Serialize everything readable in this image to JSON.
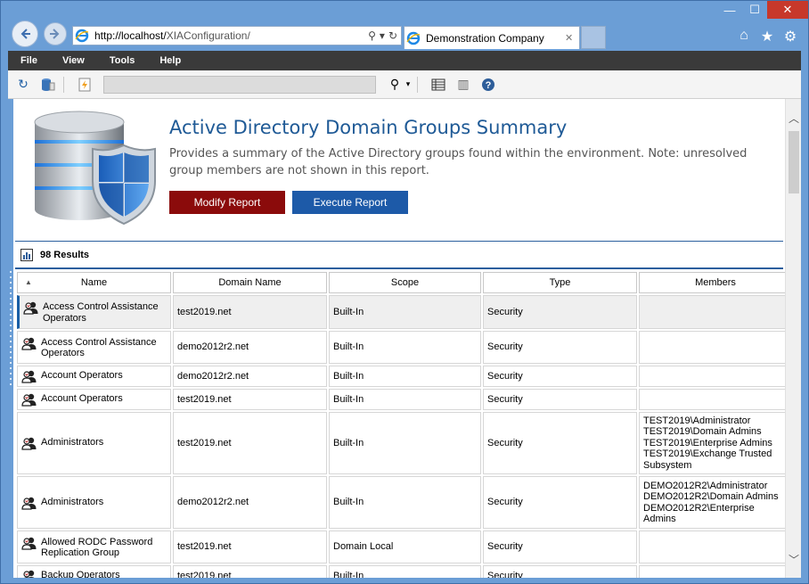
{
  "browser": {
    "url_host": "http://localhost/",
    "url_path": "XIAConfiguration/",
    "tab_title": "Demonstration Company",
    "window_controls": {
      "minimize": "—",
      "maximize": "☐",
      "close": "✕"
    }
  },
  "menu": {
    "items": [
      "File",
      "View",
      "Tools",
      "Help"
    ]
  },
  "report": {
    "title": "Active Directory Domain Groups Summary",
    "description": "Provides a summary of the Active Directory groups found within the environment. Note: unresolved group members are not shown in this report.",
    "modify_label": "Modify Report",
    "execute_label": "Execute Report",
    "results_label": "98 Results"
  },
  "table": {
    "columns": [
      "Name",
      "Domain Name",
      "Scope",
      "Type",
      "Members"
    ],
    "rows": [
      {
        "name": "Access Control Assistance Operators",
        "domain": "test2019.net",
        "scope": "Built-In",
        "type": "Security",
        "members": []
      },
      {
        "name": "Access Control Assistance Operators",
        "domain": "demo2012r2.net",
        "scope": "Built-In",
        "type": "Security",
        "members": []
      },
      {
        "name": "Account Operators",
        "domain": "demo2012r2.net",
        "scope": "Built-In",
        "type": "Security",
        "members": []
      },
      {
        "name": "Account Operators",
        "domain": "test2019.net",
        "scope": "Built-In",
        "type": "Security",
        "members": []
      },
      {
        "name": "Administrators",
        "domain": "test2019.net",
        "scope": "Built-In",
        "type": "Security",
        "members": [
          "TEST2019\\Administrator",
          "TEST2019\\Domain Admins",
          "TEST2019\\Enterprise Admins",
          "TEST2019\\Exchange Trusted Subsystem"
        ]
      },
      {
        "name": "Administrators",
        "domain": "demo2012r2.net",
        "scope": "Built-In",
        "type": "Security",
        "members": [
          "DEMO2012R2\\Administrator",
          "DEMO2012R2\\Domain Admins",
          "DEMO2012R2\\Enterprise Admins"
        ]
      },
      {
        "name": "Allowed RODC Password Replication Group",
        "domain": "test2019.net",
        "scope": "Domain Local",
        "type": "Security",
        "members": []
      },
      {
        "name": "Backup Operators",
        "domain": "test2019.net",
        "scope": "Built-In",
        "type": "Security",
        "members": []
      }
    ]
  },
  "colors": {
    "title": "#1f5a96",
    "modify_button": "#8b0b0b",
    "execute_button": "#1d5aa8",
    "menubar": "#3a3a3a",
    "frame": "#6b9ed6"
  }
}
